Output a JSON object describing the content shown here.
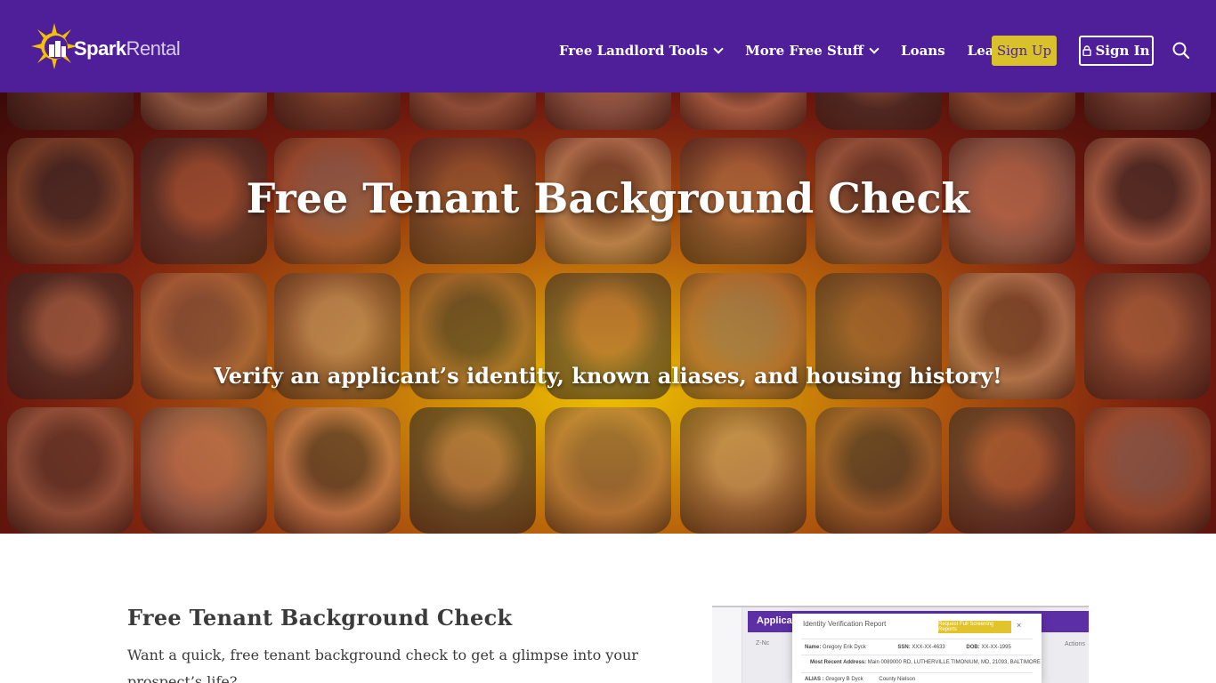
{
  "brand": {
    "name_part1": "Spark",
    "name_part2": "Rental",
    "logo_icon": "sun-house-logo-icon",
    "colors": {
      "header_bg": "#4f1f99",
      "signup_bg": "#d8c12a",
      "accent_yellow": "#f2c200"
    }
  },
  "nav": {
    "items": [
      {
        "label": "Free Landlord Tools",
        "has_dropdown": true
      },
      {
        "label": "More Free Stuff",
        "has_dropdown": true
      },
      {
        "label": "Loans",
        "has_dropdown": false
      },
      {
        "label": "Learn",
        "has_dropdown": true
      }
    ],
    "signup_label": "Sign Up",
    "signin_label": "Sign In",
    "search_icon": "search-icon",
    "lock_icon": "lock-icon"
  },
  "hero": {
    "title": "Free Tenant Background Check",
    "subtitle": "Verify an applicant’s identity, known aliases, and housing history!"
  },
  "content": {
    "heading": "Free Tenant Background Check",
    "body": "Want a quick, free tenant background check to get a glimpse into your prospect’s life?"
  },
  "preview": {
    "app_bar_label": "Applicatio",
    "modal_title": "Identity Verification Report",
    "modal_button": "Request Full Screening Reports",
    "close": "×",
    "name_label": "Name:",
    "name_value": "Gregory Erik Dyck",
    "ssn_label": "SSN:",
    "ssn_value": "XXX-XX-4633",
    "dob_label": "DOB:",
    "dob_value": "XX-XX-1995",
    "address_label": "Most Recent Address:",
    "address_value": "Main 0089000 RD, LUTHERVILLE TIMONIUM, MD, 21093, BALTIMORE",
    "alias_label": "ALIAS :",
    "alias_value": "Gregory B Dyck",
    "county_value": "County Nielson",
    "filter_label": "Z-Nc",
    "actions_label": "Actions"
  }
}
